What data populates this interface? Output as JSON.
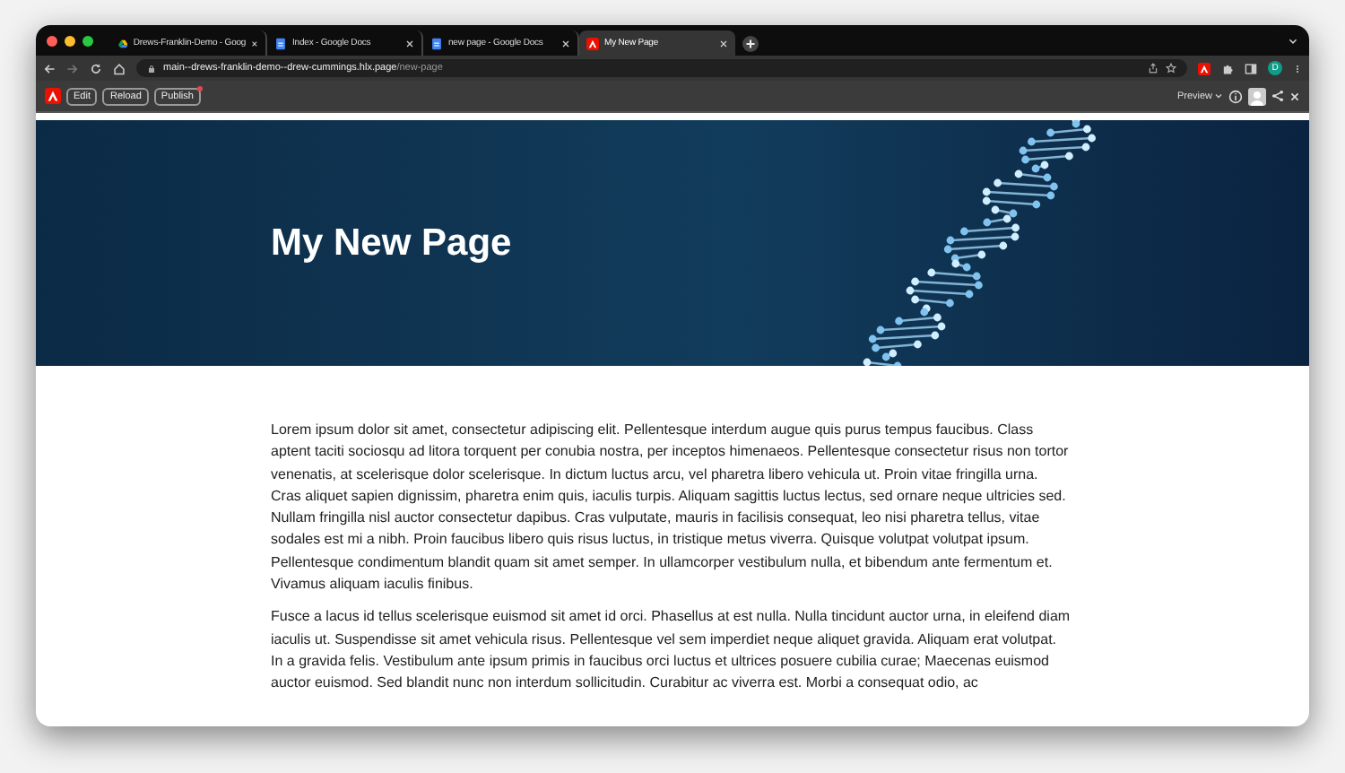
{
  "tabs": [
    {
      "kind": "drive",
      "title": "Drews-Franklin-Demo - Goog",
      "selected": false
    },
    {
      "kind": "docs",
      "title": "Index - Google Docs",
      "selected": false
    },
    {
      "kind": "docs",
      "title": "new page - Google Docs",
      "selected": false
    },
    {
      "kind": "adobe",
      "title": "My New Page",
      "selected": true
    }
  ],
  "address": {
    "host": "main--drews-franklin-demo--drew-cummings.hlx.page",
    "path": "/new-page"
  },
  "profile": {
    "initial": "D"
  },
  "sidekick": {
    "buttons": [
      {
        "label": "Edit",
        "badge": false
      },
      {
        "label": "Reload",
        "badge": false
      },
      {
        "label": "Publish",
        "badge": true
      }
    ],
    "environment": "Preview"
  },
  "page": {
    "hero_title": "My New Page",
    "paragraphs": [
      "Lorem ipsum dolor sit amet, consectetur adipiscing elit. Pellentesque interdum augue quis purus tempus faucibus. Class aptent taciti sociosqu ad litora torquent per conubia nostra, per inceptos himenaeos. Pellentesque consectetur risus non tortor venenatis, at scelerisque dolor scelerisque. In dictum luctus arcu, vel pharetra libero vehicula ut. Proin vitae fringilla urna. Cras aliquet sapien dignissim, pharetra enim quis, iaculis turpis. Aliquam sagittis luctus lectus, sed ornare neque ultricies sed. Nullam fringilla nisl auctor consectetur dapibus. Cras vulputate, mauris in facilisis consequat, leo nisi pharetra tellus, vitae sodales est mi a nibh. Proin faucibus libero quis risus luctus, in tristique metus viverra. Quisque volutpat volutpat ipsum. Pellentesque condimentum blandit quam sit amet semper. In ullamcorper vestibulum nulla, et bibendum ante fermentum et. Vivamus aliquam iaculis finibus.",
      "Fusce a lacus id tellus scelerisque euismod sit amet id orci. Phasellus at est nulla. Nulla tincidunt auctor urna, in eleifend diam iaculis ut. Suspendisse sit amet vehicula risus. Pellentesque vel sem imperdiet neque aliquet gravida. Aliquam erat volutpat. In a gravida felis. Vestibulum ante ipsum primis in faucibus orci luctus et ultrices posuere cubilia curae; Maecenas euismod auctor euismod. Sed blandit nunc non interdum sollicitudin. Curabitur ac viverra est. Morbi a consequat odio, ac"
    ]
  }
}
